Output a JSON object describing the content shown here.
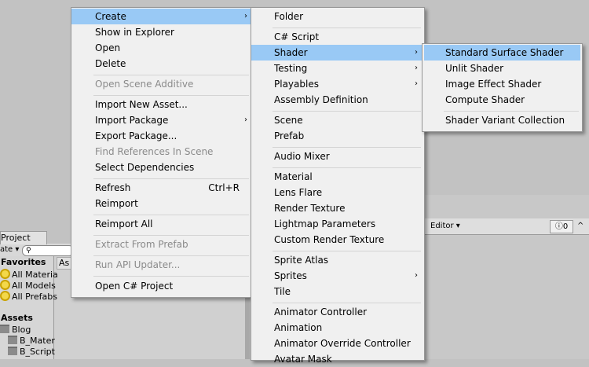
{
  "colors": {
    "highlight": "#99c9f5",
    "menu_bg": "#f0f0f0",
    "disabled": "#8a8a8a"
  },
  "editor": {
    "project_tab": "Project",
    "create_dropdown": "ate ▾",
    "search_icon": "search-icon",
    "inspector_dropdown": "Editor ▾",
    "error_count": "0",
    "breadcrumb": "As",
    "favorites": {
      "title": "Favorites",
      "items": [
        "All Materia",
        "All Models",
        "All Prefabs"
      ]
    },
    "assets": {
      "title": "Assets",
      "items": [
        "Blog",
        "B_Mater",
        "B_Script"
      ]
    }
  },
  "menu1": {
    "items": [
      {
        "label": "Create",
        "submenu": true,
        "hl": true
      },
      {
        "label": "Show in Explorer"
      },
      {
        "label": "Open"
      },
      {
        "label": "Delete"
      },
      {
        "label": "Open Scene Additive",
        "disabled": true
      },
      {
        "label": "Import New Asset..."
      },
      {
        "label": "Import Package",
        "submenu": true
      },
      {
        "label": "Export Package..."
      },
      {
        "label": "Find References In Scene",
        "disabled": true
      },
      {
        "label": "Select Dependencies"
      },
      {
        "label": "Refresh",
        "shortcut": "Ctrl+R"
      },
      {
        "label": "Reimport"
      },
      {
        "label": "Reimport All"
      },
      {
        "label": "Extract From Prefab",
        "disabled": true
      },
      {
        "label": "Run API Updater...",
        "disabled": true
      },
      {
        "label": "Open C# Project"
      }
    ]
  },
  "menu2": {
    "items": [
      {
        "label": "Folder"
      },
      {
        "label": "C# Script"
      },
      {
        "label": "Shader",
        "submenu": true,
        "hl": true
      },
      {
        "label": "Testing",
        "submenu": true
      },
      {
        "label": "Playables",
        "submenu": true
      },
      {
        "label": "Assembly Definition"
      },
      {
        "label": "Scene"
      },
      {
        "label": "Prefab"
      },
      {
        "label": "Audio Mixer"
      },
      {
        "label": "Material"
      },
      {
        "label": "Lens Flare"
      },
      {
        "label": "Render Texture"
      },
      {
        "label": "Lightmap Parameters"
      },
      {
        "label": "Custom Render Texture"
      },
      {
        "label": "Sprite Atlas"
      },
      {
        "label": "Sprites",
        "submenu": true
      },
      {
        "label": "Tile"
      },
      {
        "label": "Animator Controller"
      },
      {
        "label": "Animation"
      },
      {
        "label": "Animator Override Controller"
      },
      {
        "label": "Avatar Mask"
      }
    ]
  },
  "menu3": {
    "items": [
      {
        "label": "Standard Surface Shader",
        "hl": true
      },
      {
        "label": "Unlit Shader"
      },
      {
        "label": "Image Effect Shader"
      },
      {
        "label": "Compute Shader"
      },
      {
        "label": "Shader Variant Collection"
      }
    ]
  }
}
